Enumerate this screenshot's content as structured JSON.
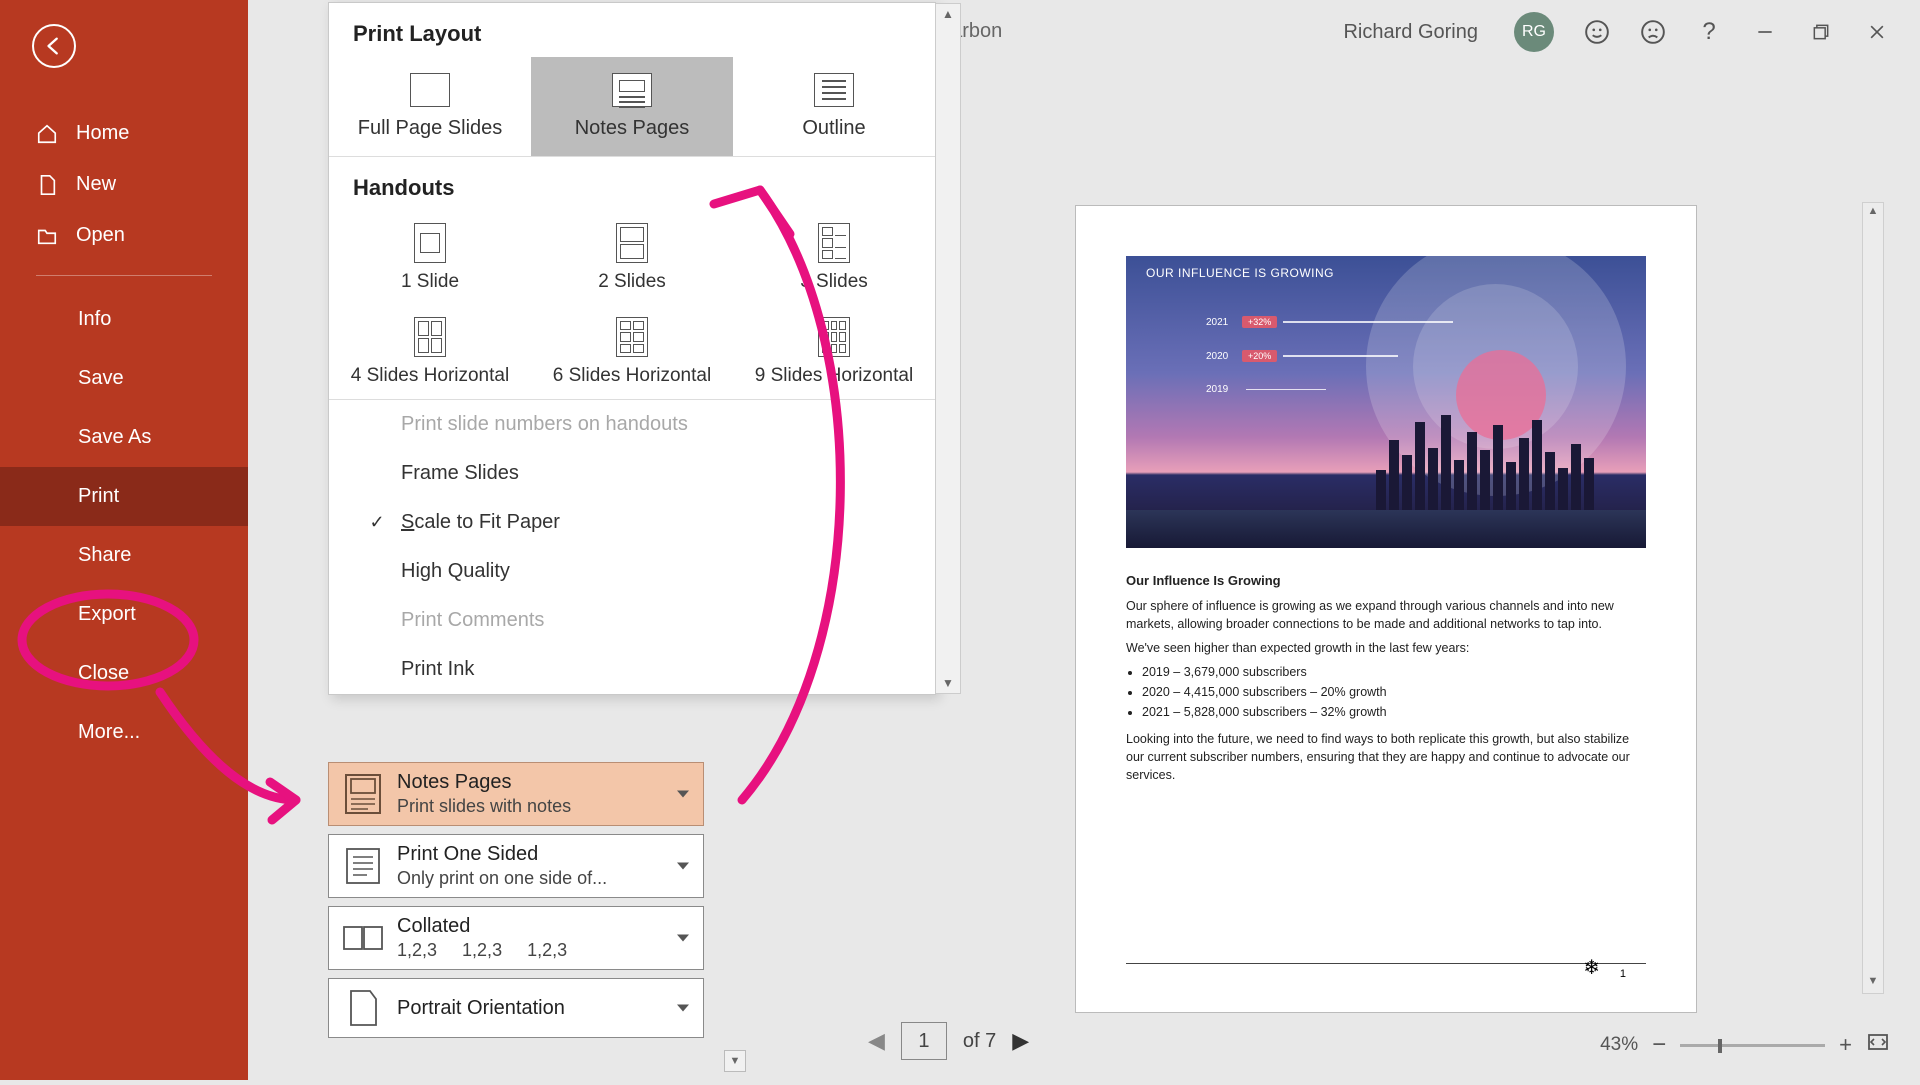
{
  "titlebar": {
    "filename_fragment": "htCarbon",
    "user": "Richard Goring",
    "initials": "RG"
  },
  "sidebar": {
    "home": "Home",
    "new": "New",
    "open": "Open",
    "info": "Info",
    "save": "Save",
    "save_as": "Save As",
    "print": "Print",
    "share": "Share",
    "export": "Export",
    "close": "Close",
    "more": "More..."
  },
  "popup": {
    "section_layout": "Print Layout",
    "opts": {
      "full_page": "Full Page Slides",
      "notes_pages": "Notes Pages",
      "outline": "Outline"
    },
    "section_handouts": "Handouts",
    "handouts": {
      "s1": "1 Slide",
      "s2": "2 Slides",
      "s3": "3 Slides",
      "s4": "4 Slides Horizontal",
      "s6": "6 Slides Horizontal",
      "s9": "9 Slides Horizontal"
    },
    "options": {
      "slide_numbers": "Print slide numbers on handouts",
      "frame": "Frame Slides",
      "scale": "Scale to Fit Paper",
      "quality": "High Quality",
      "comments": "Print Comments",
      "ink": "Print Ink"
    }
  },
  "settings": {
    "notes": {
      "title": "Notes Pages",
      "sub": "Print slides with notes"
    },
    "sided": {
      "title": "Print One Sided",
      "sub": "Only print on one side of..."
    },
    "collated": {
      "title": "Collated",
      "sub": "1,2,3     1,2,3     1,2,3"
    },
    "orient": {
      "title": "Portrait Orientation"
    }
  },
  "preview": {
    "slide_title": "OUR INFLUENCE IS GROWING",
    "rows": [
      {
        "year": "2021",
        "pct": "+32%"
      },
      {
        "year": "2020",
        "pct": "+20%"
      },
      {
        "year": "2019",
        "pct": ""
      }
    ],
    "notes_title": "Our Influence Is Growing",
    "p1": "Our sphere of influence is growing as we expand through various channels and into new markets, allowing broader connections to be made and additional networks to tap into.",
    "p2": "We've seen higher than expected growth in the last few years:",
    "b1": "2019 – 3,679,000 subscribers",
    "b2": "2020 – 4,415,000 subscribers – 20% growth",
    "b3": "2021 – 5,828,000 subscribers – 32% growth",
    "p3": "Looking into the future, we need to find ways to both replicate this growth, but also stabilize our current subscriber numbers, ensuring that they are happy and continue to advocate our services.",
    "page_num": "1"
  },
  "nav": {
    "current": "1",
    "total": "of 7"
  },
  "zoom": {
    "pct": "43%"
  }
}
